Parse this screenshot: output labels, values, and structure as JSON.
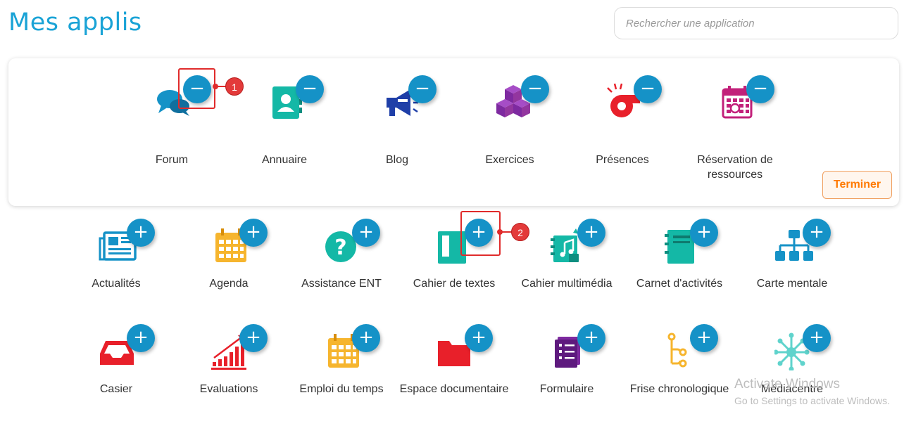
{
  "page": {
    "title": "Mes applis"
  },
  "search": {
    "placeholder": "Rechercher une application"
  },
  "pinned": {
    "apps": [
      {
        "label": "Forum",
        "icon": "forum-icon"
      },
      {
        "label": "Annuaire",
        "icon": "address-book-icon"
      },
      {
        "label": "Blog",
        "icon": "megaphone-icon"
      },
      {
        "label": "Exercices",
        "icon": "cubes-icon"
      },
      {
        "label": "Présences",
        "icon": "whistle-icon"
      },
      {
        "label": "Réservation de ressources",
        "icon": "calendar-booking-icon"
      }
    ],
    "remove_symbol": "−",
    "finish_label": "Terminer"
  },
  "available": {
    "add_symbol": "+",
    "apps": [
      {
        "label": "Actualités",
        "icon": "newspaper-icon"
      },
      {
        "label": "Agenda",
        "icon": "calendar-icon"
      },
      {
        "label": "Assistance ENT",
        "icon": "help-icon"
      },
      {
        "label": "Cahier de textes",
        "icon": "notebook-icon"
      },
      {
        "label": "Cahier multimédia",
        "icon": "multimedia-book-icon"
      },
      {
        "label": "Carnet d'activités",
        "icon": "activity-notebook-icon"
      },
      {
        "label": "Carte mentale",
        "icon": "mind-map-icon"
      },
      {
        "label": "Casier",
        "icon": "inbox-tray-icon"
      },
      {
        "label": "Evaluations",
        "icon": "bar-growth-icon"
      },
      {
        "label": "Emploi du temps",
        "icon": "timetable-icon"
      },
      {
        "label": "Espace documentaire",
        "icon": "folder-icon"
      },
      {
        "label": "Formulaire",
        "icon": "form-icon"
      },
      {
        "label": "Frise chronologique",
        "icon": "timeline-icon"
      },
      {
        "label": "Médiacentre",
        "icon": "network-icon"
      }
    ]
  },
  "annotations": {
    "marker1": "1",
    "marker2": "2"
  },
  "watermark": {
    "line1": "Activate Windows",
    "line2": "Go to Settings to activate Windows."
  },
  "colors": {
    "accent": "#1592c7",
    "title": "#1aa3d6",
    "finish": "#ff7a00",
    "annotation": "#e02b2b"
  }
}
